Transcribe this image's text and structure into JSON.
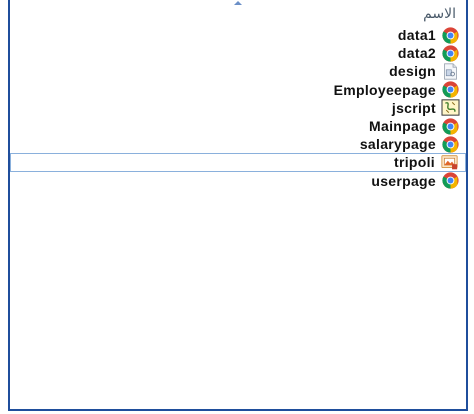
{
  "header": {
    "column_name": "الاسم"
  },
  "files": [
    {
      "name": "data1",
      "icon": "chrome-icon"
    },
    {
      "name": "data2",
      "icon": "chrome-icon"
    },
    {
      "name": "design",
      "icon": "css-file-icon"
    },
    {
      "name": "Employeepage",
      "icon": "chrome-icon"
    },
    {
      "name": "jscript",
      "icon": "javascript-file-icon"
    },
    {
      "name": "Mainpage",
      "icon": "chrome-icon"
    },
    {
      "name": "salarypage",
      "icon": "chrome-icon"
    },
    {
      "name": "tripoli",
      "icon": "image-file-icon",
      "selected": true
    },
    {
      "name": "userpage",
      "icon": "chrome-icon"
    }
  ],
  "colors": {
    "border": "#1f4e9c",
    "selection_border": "#8ab0dc"
  }
}
